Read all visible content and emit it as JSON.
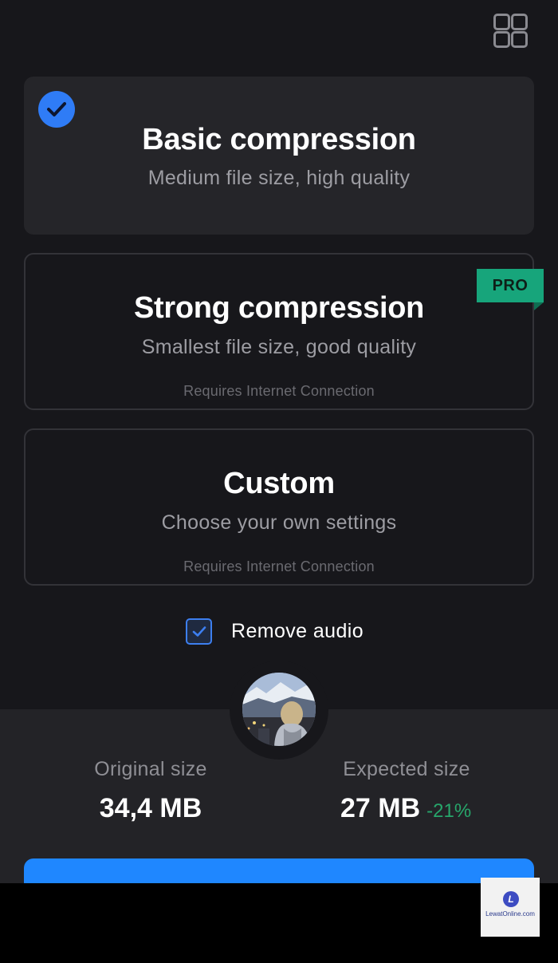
{
  "header": {
    "menu_icon": "grid-icon"
  },
  "options": [
    {
      "title": "Basic compression",
      "subtitle": "Medium file size, high quality",
      "selected": true
    },
    {
      "title": "Strong compression",
      "subtitle": "Smallest file size, good quality",
      "note": "Requires Internet Connection",
      "badge": "PRO"
    },
    {
      "title": "Custom",
      "subtitle": "Choose your own settings",
      "note": "Requires Internet Connection"
    }
  ],
  "remove_audio": {
    "label": "Remove audio",
    "checked": true
  },
  "stats": {
    "original_label": "Original size",
    "original_value": "34,4 MB",
    "expected_label": "Expected size",
    "expected_value": "27 MB",
    "expected_change": "-21%"
  },
  "watermark": {
    "logo_letter": "L",
    "text": "LewatOnline.com"
  },
  "colors": {
    "accent": "#2f7cf6",
    "pro_badge": "#17a57b",
    "positive": "#27a66b",
    "cta": "#1f87ff"
  }
}
